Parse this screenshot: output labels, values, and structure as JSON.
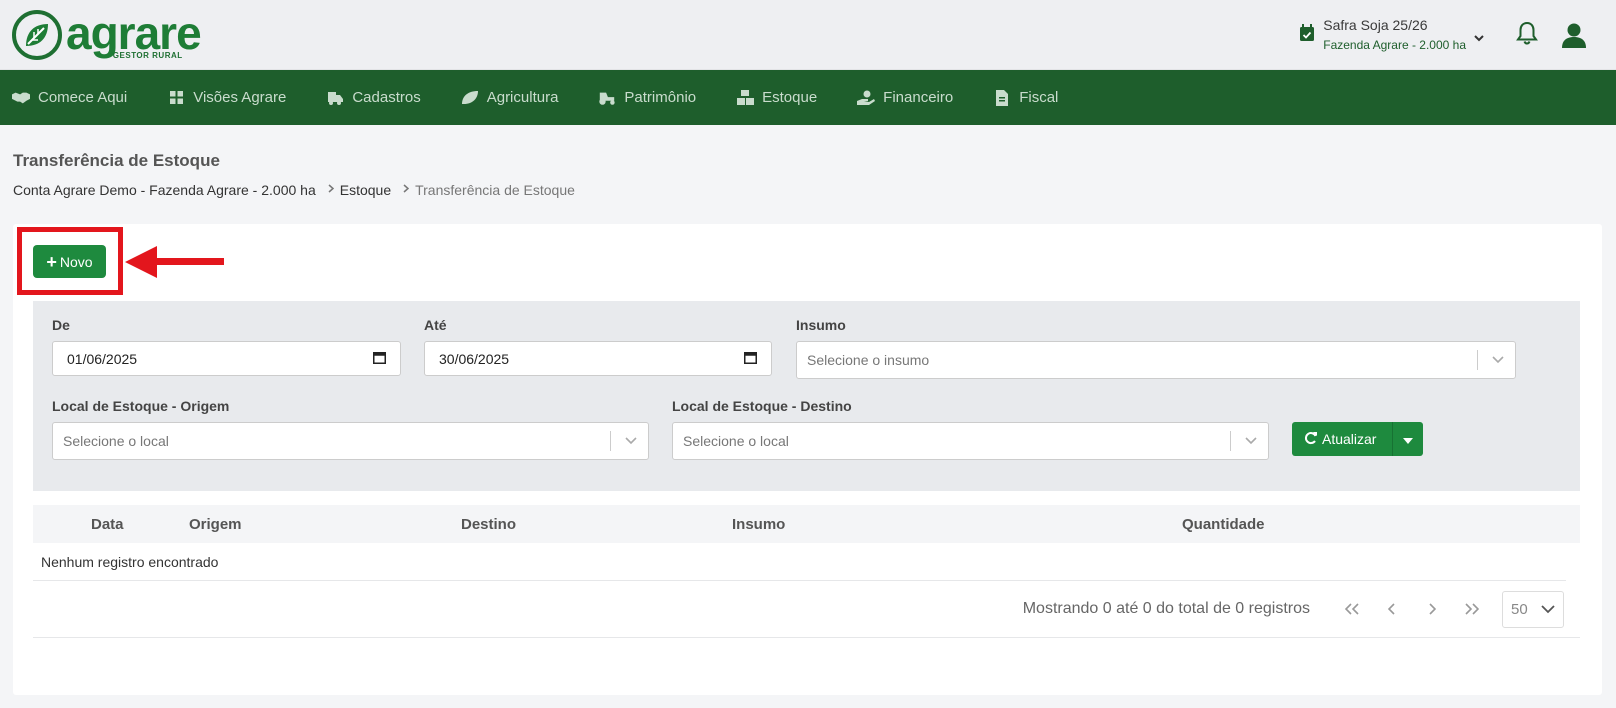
{
  "header": {
    "logo_word": "agrare",
    "logo_sub": "GESTOR RURAL",
    "safra_title": "Safra Soja 25/26",
    "safra_sub": "Fazenda Agrare - 2.000 ha",
    "icons": [
      "calendar-check-icon",
      "chevron-down-icon",
      "bell-icon",
      "user-icon"
    ]
  },
  "nav": {
    "items": [
      {
        "label": "Comece Aqui",
        "icon": "handshake-icon"
      },
      {
        "label": "Visões Agrare",
        "icon": "grid-icon"
      },
      {
        "label": "Cadastros",
        "icon": "truck-icon"
      },
      {
        "label": "Agricultura",
        "icon": "leaf-icon"
      },
      {
        "label": "Patrimônio",
        "icon": "tractor-icon"
      },
      {
        "label": "Estoque",
        "icon": "boxes-icon"
      },
      {
        "label": "Financeiro",
        "icon": "hand-dollar-icon"
      },
      {
        "label": "Fiscal",
        "icon": "file-invoice-icon"
      }
    ]
  },
  "page": {
    "title": "Transferência de Estoque",
    "breadcrumb": [
      "Conta Agrare Demo - Fazenda Agrare - 2.000 ha",
      "Estoque",
      "Transferência de Estoque"
    ]
  },
  "toolbar": {
    "novo_label": "Novo"
  },
  "filters": {
    "de_label": "De",
    "de_value": "01/06/2025",
    "ate_label": "Até",
    "ate_value": "30/06/2025",
    "insumo_label": "Insumo",
    "insumo_placeholder": "Selecione o insumo",
    "origem_label": "Local de Estoque - Origem",
    "origem_placeholder": "Selecione o local",
    "destino_label": "Local de Estoque - Destino",
    "destino_placeholder": "Selecione o local",
    "atualizar_label": "Atualizar"
  },
  "table": {
    "columns": [
      "Data",
      "Origem",
      "Destino",
      "Insumo",
      "Quantidade"
    ],
    "empty_message": "Nenhum registro encontrado",
    "pager_info": "Mostrando 0 até 0 do total de 0 registros",
    "page_size": "50"
  },
  "colors": {
    "brand_green": "#1e5e2c",
    "button_green": "#1e8a3e",
    "highlight_red": "#e3161d"
  }
}
